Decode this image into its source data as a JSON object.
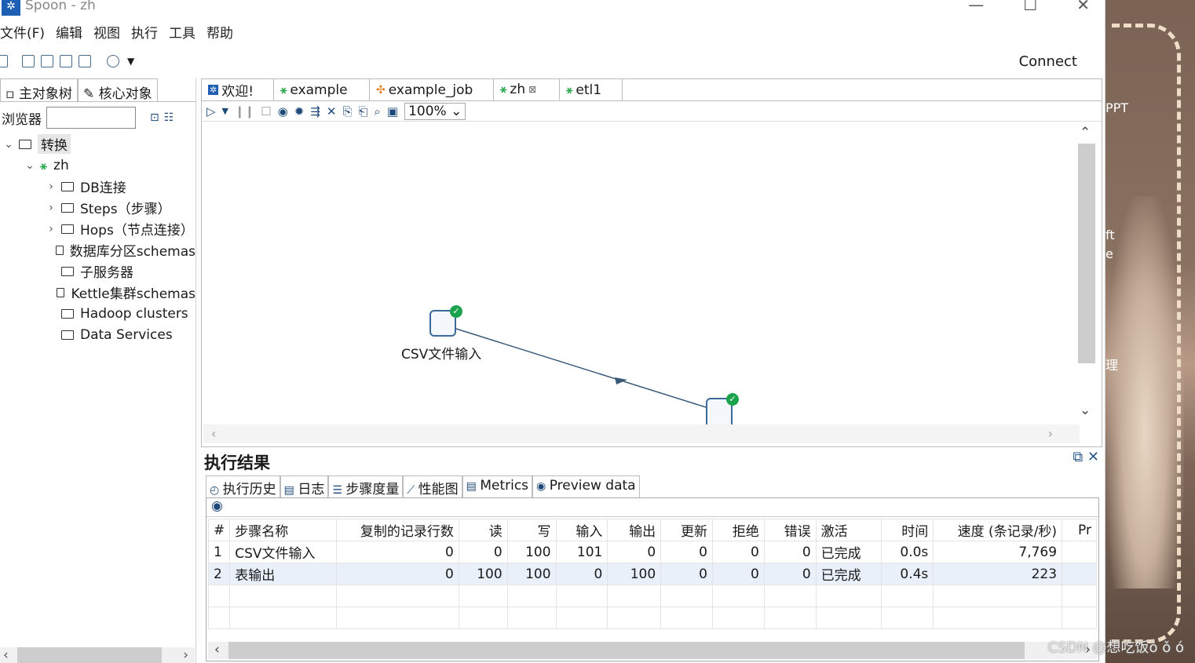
{
  "window": {
    "title": "Spoon - zh",
    "minimize": "—",
    "maximize": "☐",
    "close": "✕"
  },
  "menu": [
    "文件(F)",
    "编辑",
    "视图",
    "执行",
    "工具",
    "帮助"
  ],
  "toolbar": {
    "connect": "Connect"
  },
  "left": {
    "tabs": [
      "主对象树",
      "核心对象"
    ],
    "browse_label": "浏览器",
    "tree": [
      {
        "label": "转换",
        "level": 0,
        "expanded": true,
        "icon": "folder-icon"
      },
      {
        "label": "zh",
        "level": 1,
        "expanded": true,
        "icon": "transformation-icon"
      },
      {
        "label": "DB连接",
        "level": 2,
        "expandable": true,
        "icon": "folder-icon"
      },
      {
        "label": "Steps（步骤）",
        "level": 2,
        "expandable": true,
        "icon": "folder-icon"
      },
      {
        "label": "Hops（节点连接）",
        "level": 2,
        "expandable": true,
        "icon": "folder-icon"
      },
      {
        "label": "数据库分区schemas",
        "level": 2,
        "icon": "folder-icon"
      },
      {
        "label": "子服务器",
        "level": 2,
        "icon": "folder-icon"
      },
      {
        "label": "Kettle集群schemas",
        "level": 2,
        "icon": "folder-icon"
      },
      {
        "label": "Hadoop clusters",
        "level": 2,
        "icon": "folder-icon"
      },
      {
        "label": "Data Services",
        "level": 2,
        "icon": "folder-icon"
      }
    ]
  },
  "editor": {
    "tabs": [
      {
        "label": "欢迎!",
        "icon": "home-icon"
      },
      {
        "label": "example",
        "icon": "transformation-icon"
      },
      {
        "label": "example_job",
        "icon": "job-icon"
      },
      {
        "label": "zh",
        "icon": "transformation-icon",
        "active": true,
        "closable": "⊠"
      },
      {
        "label": "etl1",
        "icon": "transformation-icon"
      }
    ],
    "zoom": "100%",
    "steps": [
      {
        "label": "CSV文件输入"
      }
    ]
  },
  "results": {
    "title": "执行结果",
    "tabs": [
      "执行历史",
      "日志",
      "步骤度量",
      "性能图",
      "Metrics",
      "Preview data"
    ],
    "active_tab": "步骤度量",
    "columns": [
      "#",
      "步骤名称",
      "复制的记录行数",
      "读",
      "写",
      "输入",
      "输出",
      "更新",
      "拒绝",
      "错误",
      "激活",
      "时间",
      "速度 (条记录/秒)",
      "Pr"
    ],
    "rows": [
      [
        "1",
        "CSV文件输入",
        "0",
        "0",
        "100",
        "101",
        "0",
        "0",
        "0",
        "0",
        "已完成",
        "0.0s",
        "7,769",
        ""
      ],
      [
        "2",
        "表输出",
        "0",
        "100",
        "100",
        "0",
        "100",
        "0",
        "0",
        "0",
        "已完成",
        "0.4s",
        "223",
        ""
      ]
    ]
  },
  "desktop": {
    "labels": [
      "PPT",
      "ft",
      "e",
      "理"
    ]
  },
  "watermark": "CSDN @想吃饭ò ǒ ó"
}
